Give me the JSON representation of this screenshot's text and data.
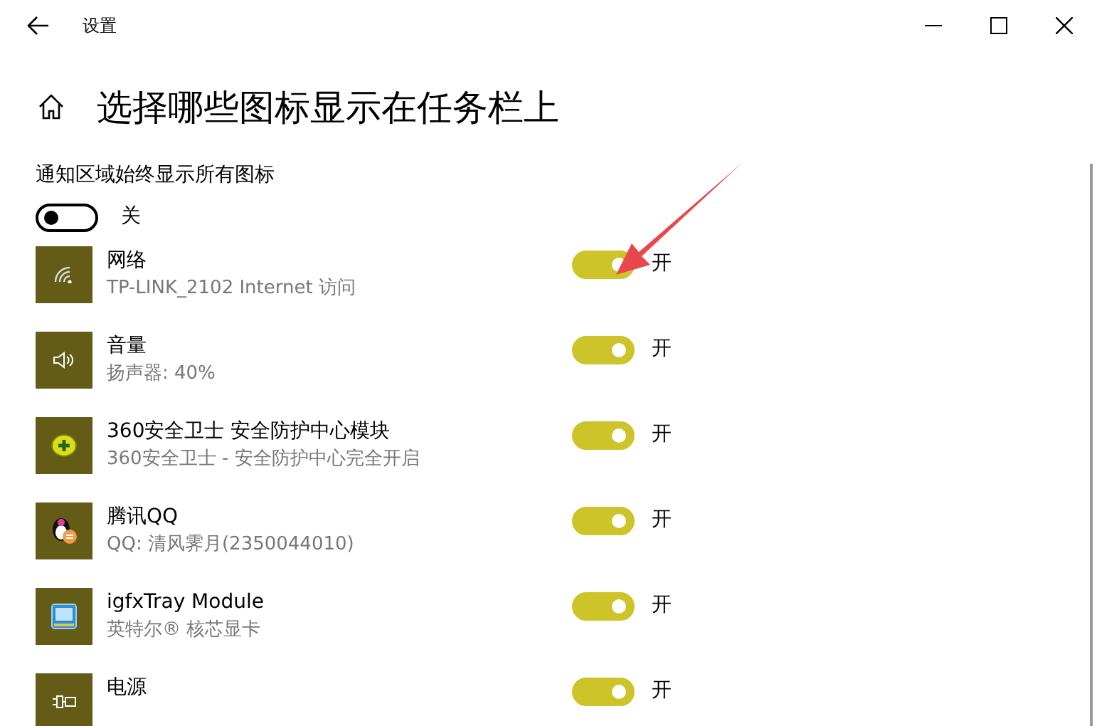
{
  "window": {
    "title": "设置"
  },
  "heading": "选择哪些图标显示在任务栏上",
  "always_show": {
    "label": "通知区域始终显示所有图标",
    "on": false,
    "state_label": "关"
  },
  "items": [
    {
      "kind": "network",
      "title": "网络",
      "subtitle": "TP-LINK_2102 Internet 访问",
      "on": true,
      "state_label": "开"
    },
    {
      "kind": "volume",
      "title": "音量",
      "subtitle": "扬声器: 40%",
      "on": true,
      "state_label": "开"
    },
    {
      "kind": "security",
      "title": "360安全卫士 安全防护中心模块",
      "subtitle": "360安全卫士 - 安全防护中心完全开启",
      "on": true,
      "state_label": "开"
    },
    {
      "kind": "chat",
      "title": "腾讯QQ",
      "subtitle": "QQ: 清风霁月(2350044010)",
      "on": true,
      "state_label": "开"
    },
    {
      "kind": "graphics",
      "title": "igfxTray Module",
      "subtitle": "英特尔® 核芯显卡",
      "on": true,
      "state_label": "开"
    },
    {
      "kind": "power",
      "title": "电源",
      "on": true,
      "state_label": "开"
    }
  ]
}
